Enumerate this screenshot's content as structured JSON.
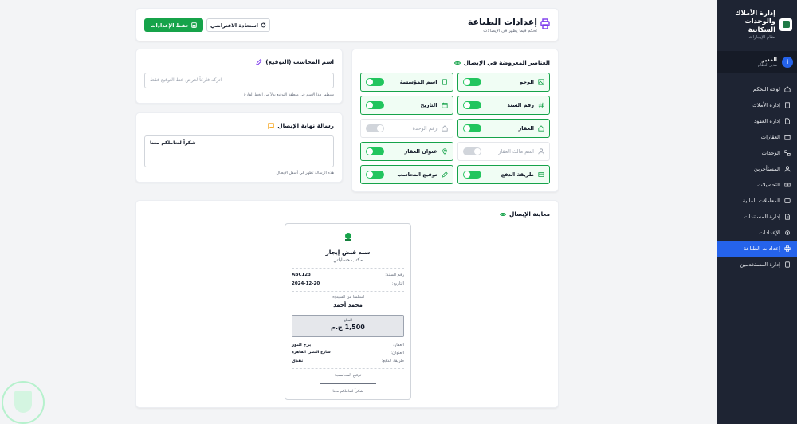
{
  "sidebar": {
    "title": "إدارة الأملاك والوحدات السكانية",
    "subtitle": "نظام الإيجارات",
    "user": {
      "initial": "أ",
      "name": "المدير",
      "role": "مدير النظام"
    },
    "items": [
      {
        "label": "لوحة التحكم",
        "icon": "dashboard-icon",
        "active": false
      },
      {
        "label": "إدارة الأملاك",
        "icon": "building-icon",
        "active": false
      },
      {
        "label": "إدارة العقود",
        "icon": "document-icon",
        "active": false
      },
      {
        "label": "العقارات",
        "icon": "property-icon",
        "active": false
      },
      {
        "label": "الوحدات",
        "icon": "units-icon",
        "active": false
      },
      {
        "label": "المستأجرين",
        "icon": "users-icon",
        "active": false
      },
      {
        "label": "التحصيلات",
        "icon": "cash-icon",
        "active": false
      },
      {
        "label": "المعاملات المالية",
        "icon": "wallet-icon",
        "active": false
      },
      {
        "label": "إدارة المستندات",
        "icon": "files-icon",
        "active": false
      },
      {
        "label": "الإعدادات",
        "icon": "gear-icon",
        "active": false
      },
      {
        "label": "إعدادات الطباعة",
        "icon": "printer-icon",
        "active": true
      },
      {
        "label": "إدارة المستخدمين",
        "icon": "user-admin-icon",
        "active": false
      }
    ]
  },
  "header": {
    "title": "إعدادات الطباعة",
    "subtitle": "تحكم فيما يظهر في الإيصالات",
    "save_label": "حفظ الإعدادات",
    "reset_label": "استعادة الافتراضي"
  },
  "elements": {
    "title": "العناصر المعروضة في الإيصال",
    "items": [
      {
        "label": "الوجو",
        "icon": "image-icon",
        "on": true
      },
      {
        "label": "اسم المؤسسة",
        "icon": "building-icon",
        "on": true
      },
      {
        "label": "رقم السند",
        "icon": "hash-icon",
        "on": true
      },
      {
        "label": "التاريخ",
        "icon": "calendar-icon",
        "on": true
      },
      {
        "label": "العقار",
        "icon": "home-icon",
        "on": true
      },
      {
        "label": "رقم الوحدة",
        "icon": "home-icon",
        "on": false
      },
      {
        "label": "اسم مالك العقار",
        "icon": "user-icon",
        "on": false
      },
      {
        "label": "عنوان العقار",
        "icon": "pin-icon",
        "on": true
      },
      {
        "label": "طريقة الدفع",
        "icon": "card-icon",
        "on": true
      },
      {
        "label": "توقيع المحاسب",
        "icon": "pen-icon",
        "on": true
      }
    ]
  },
  "accountant": {
    "title": "اسم المحاسب (التوقيع)",
    "placeholder": "اتركه فارغاً لعرض خط التوقيع فقط",
    "hint": "سيظهر هذا الاسم في منطقة التوقيع بدلاً من الخط الفارغ"
  },
  "end_message": {
    "title": "رسالة نهاية الإيصال",
    "value": "شكراً لتعاملكم معنا",
    "hint": "هذه الرسالة تظهر في أسفل الإيصال"
  },
  "preview": {
    "title": "معاينة الإيصال",
    "receipt_title": "سند قبض إيجار",
    "office": "مكتب حساباتي",
    "receipt_no_label": "رقم السند:",
    "receipt_no": "ABC123",
    "date_label": "التاريخ:",
    "date": "2024-12-20",
    "received_from_label": "استلمنا من السيد/ة:",
    "payer": "محمد أحمد",
    "amount_label": "المبلغ",
    "amount": "1,500 ج.م",
    "property_label": "العقار:",
    "property": "برج النور",
    "address_label": "العنوان:",
    "address": "شارع النصر، القاهرة",
    "method_label": "طريقة الدفع:",
    "method": "نقدي",
    "signature_label": "توقيع المحاسب:",
    "footer": "شكراً لتعاملكم معنا"
  },
  "colors": {
    "primary": "#16a34a",
    "sidebar": "#1e2433",
    "active": "#2563eb",
    "accent": "#7c3aed"
  }
}
